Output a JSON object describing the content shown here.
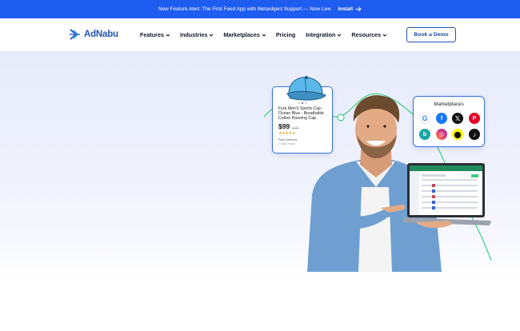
{
  "announcement": {
    "text": "New Feature Alert: The First Feed App with Metaobject Support — Now Live",
    "cta_label": "Install"
  },
  "header": {
    "logo_text": "AdNabu",
    "nav": [
      {
        "label": "Features",
        "has_dropdown": true
      },
      {
        "label": "Industries",
        "has_dropdown": true
      },
      {
        "label": "Marketplaces",
        "has_dropdown": true
      },
      {
        "label": "Pricing",
        "has_dropdown": false
      },
      {
        "label": "Integration",
        "has_dropdown": true
      },
      {
        "label": "Resources",
        "has_dropdown": true
      }
    ],
    "demo_button_label": "Book a Demo"
  },
  "product_card": {
    "title": "Fyre Men's Sports Cap - Ocean Blue - Breathable Cotton Running Cap",
    "price": "$99",
    "old_price": "$150",
    "stars": "★★★★★",
    "delivery": "Free Delivery",
    "returns": "7 days return"
  },
  "marketplaces_card": {
    "title": "Marketplaces",
    "icons": [
      "google-icon",
      "facebook-icon",
      "x-icon",
      "pinterest-icon",
      "bing-icon",
      "instagram-icon",
      "snapchat-icon",
      "tiktok-icon"
    ]
  },
  "colors": {
    "announcement_bg": "#1f5cf0",
    "brand_blue": "#2256b4",
    "hero_bg": "#e6ebfb",
    "accent_green": "#3ccf7a"
  }
}
